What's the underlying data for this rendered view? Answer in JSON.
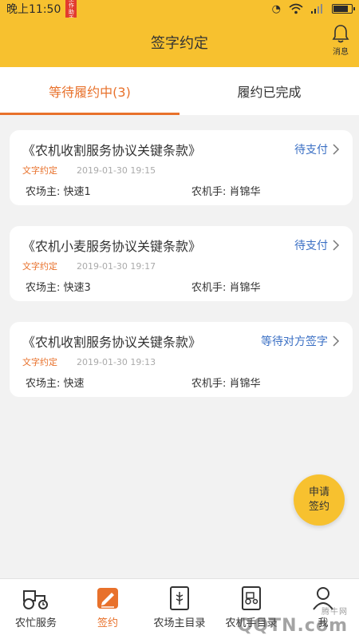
{
  "status_bar": {
    "time": "晚上11:50",
    "badge": "工作助手"
  },
  "header": {
    "title": "签字约定",
    "message_label": "消息"
  },
  "tabs": [
    {
      "label": "等待履约中(3)",
      "active": true
    },
    {
      "label": "履约已完成",
      "active": false
    }
  ],
  "cards": [
    {
      "title": "《农机收割服务协议关键条款》",
      "status": "待支付",
      "tag": "文字约定",
      "date": "2019-01-30 19:15",
      "farm_owner": "农场主: 快速1",
      "operator": "农机手: 肖锦华"
    },
    {
      "title": "《农机小麦服务协议关键条款》",
      "status": "待支付",
      "tag": "文字约定",
      "date": "2019-01-30 19:17",
      "farm_owner": "农场主: 快速3",
      "operator": "农机手: 肖锦华"
    },
    {
      "title": "《农机收割服务协议关键条款》",
      "status": "等待对方签字",
      "tag": "文字约定",
      "date": "2019-01-30 19:13",
      "farm_owner": "农场主: 快速",
      "operator": "农机手: 肖锦华"
    }
  ],
  "fab": {
    "line1": "申请",
    "line2": "签约"
  },
  "bottom_nav": [
    {
      "label": "农忙服务",
      "icon": "tractor-icon",
      "active": false
    },
    {
      "label": "签约",
      "icon": "sign-icon",
      "active": true
    },
    {
      "label": "农场主目录",
      "icon": "farm-directory-icon",
      "active": false
    },
    {
      "label": "农机手目录",
      "icon": "operator-directory-icon",
      "active": false
    },
    {
      "label": "我",
      "icon": "user-icon",
      "active": false
    }
  ],
  "watermark": {
    "text": "QQTN.com",
    "sub": "腾牛网"
  },
  "colors": {
    "accent": "#f7c12f",
    "active": "#e8712b",
    "link": "#3a6fc4"
  }
}
